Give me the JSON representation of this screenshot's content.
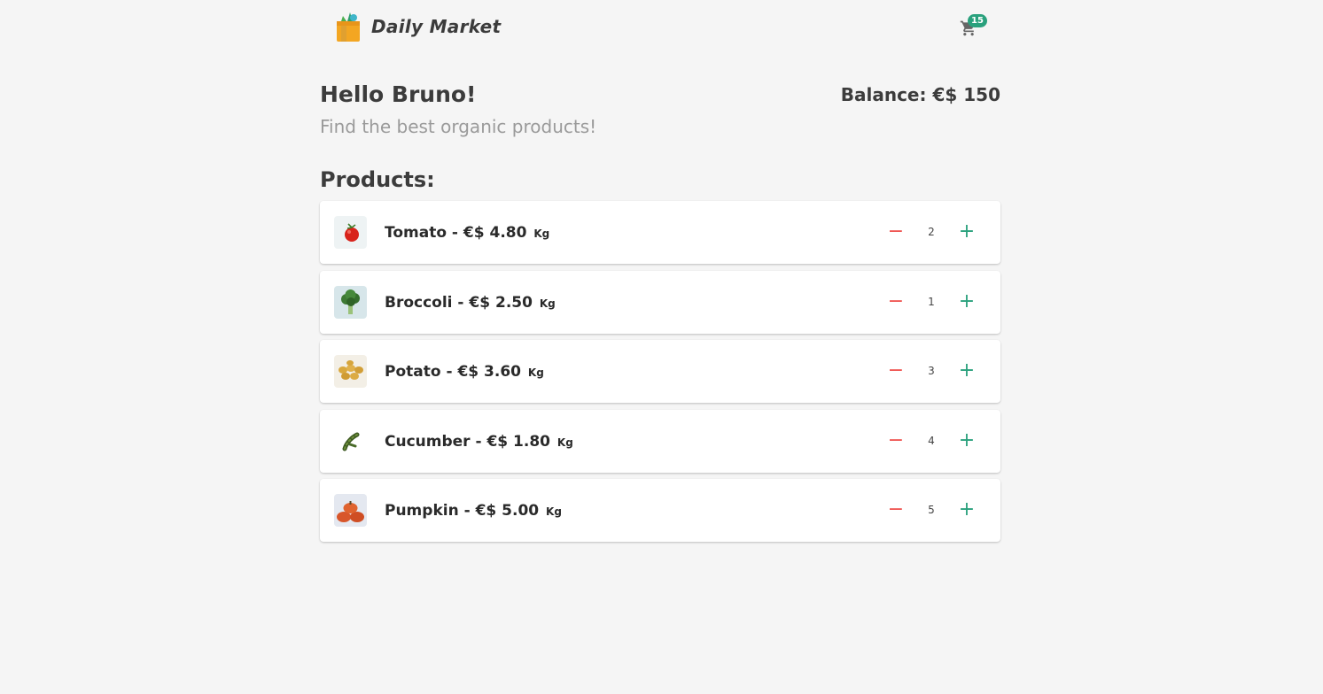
{
  "header": {
    "brand": "Daily Market",
    "cart_count": "15"
  },
  "greeting": "Hello Bruno!",
  "subtitle": "Find the best organic products!",
  "balance": "Balance: €$ 150",
  "products_title": "Products:",
  "products": [
    {
      "name": "Tomato",
      "price": "€$ 4.80",
      "unit": "Kg",
      "quantity": "2",
      "icon": "tomato-icon"
    },
    {
      "name": "Broccoli",
      "price": "€$ 2.50",
      "unit": "Kg",
      "quantity": "1",
      "icon": "broccoli-icon"
    },
    {
      "name": "Potato",
      "price": "€$ 3.60",
      "unit": "Kg",
      "quantity": "3",
      "icon": "potato-icon"
    },
    {
      "name": "Cucumber",
      "price": "€$ 1.80",
      "unit": "Kg",
      "quantity": "4",
      "icon": "cucumber-icon"
    },
    {
      "name": "Pumpkin",
      "price": "€$ 5.00",
      "unit": "Kg",
      "quantity": "5",
      "icon": "pumpkin-icon"
    }
  ],
  "controls": {
    "minus": "−",
    "plus": "+"
  },
  "colors": {
    "accent": "#2aa17d",
    "minus": "#ef5350",
    "background": "#f5f5f5"
  }
}
